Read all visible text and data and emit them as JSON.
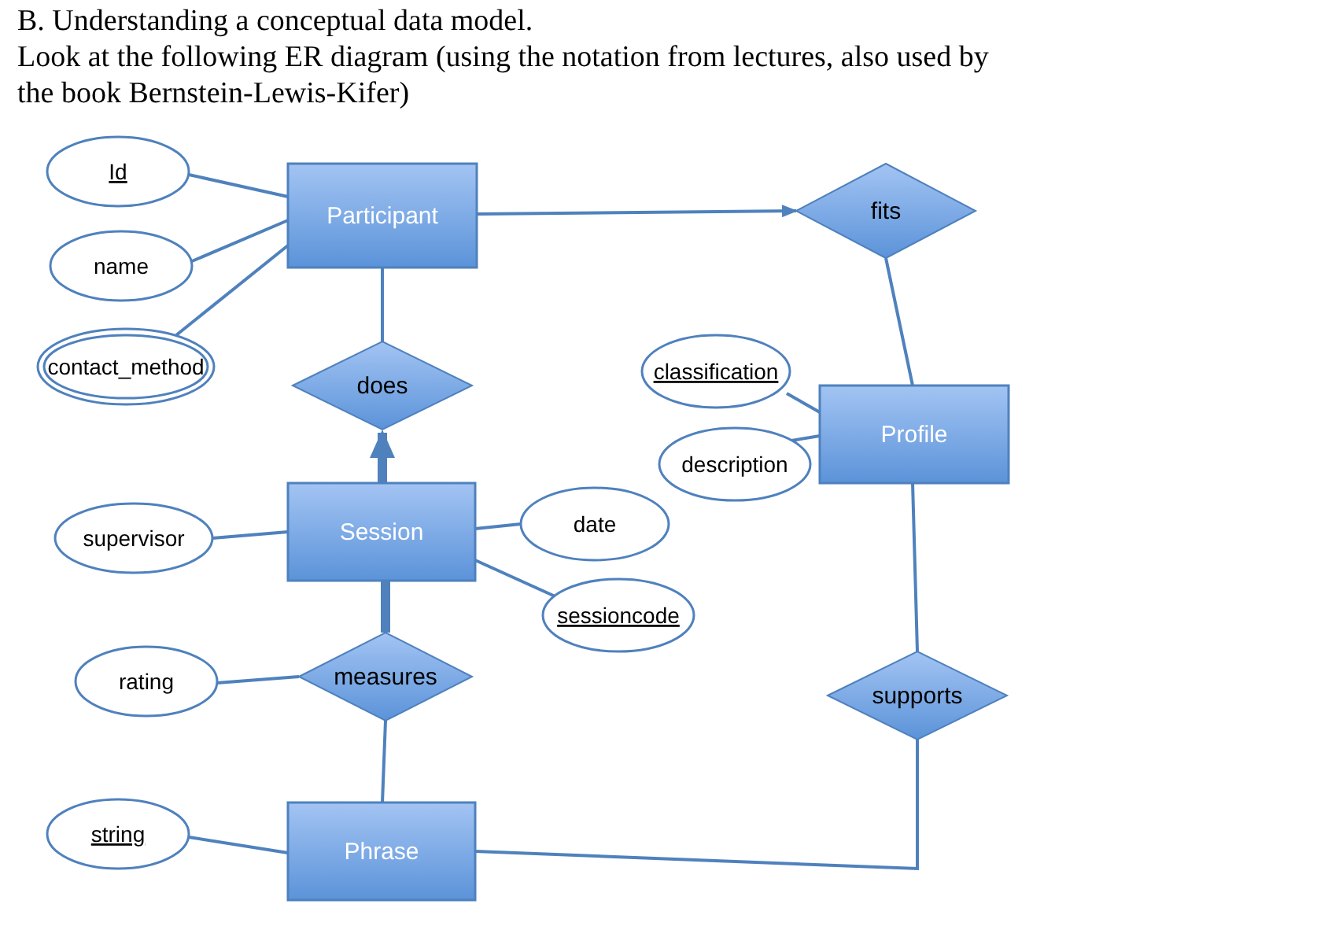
{
  "heading": {
    "title": "B. Understanding a conceptual data model.",
    "lines": [
      "Look at the following ER diagram (using the notation from lectures, also used by",
      "the book Bernstein-Lewis-Kifer)"
    ]
  },
  "diagram": {
    "entities": [
      {
        "name": "Participant"
      },
      {
        "name": "Session"
      },
      {
        "name": "Profile"
      },
      {
        "name": "Phrase"
      }
    ],
    "relationships": [
      {
        "name": "fits"
      },
      {
        "name": "does"
      },
      {
        "name": "measures"
      },
      {
        "name": "supports"
      }
    ],
    "attributes": [
      {
        "label": "Id",
        "key": true,
        "multivalued": false
      },
      {
        "label": "name",
        "key": false,
        "multivalued": false
      },
      {
        "label": "contact_method",
        "key": false,
        "multivalued": true
      },
      {
        "label": "supervisor",
        "key": false,
        "multivalued": false
      },
      {
        "label": "rating",
        "key": false,
        "multivalued": false
      },
      {
        "label": "string",
        "key": true,
        "multivalued": false
      },
      {
        "label": "classification",
        "key": true,
        "multivalued": false
      },
      {
        "label": "description",
        "key": false,
        "multivalued": false
      },
      {
        "label": "date",
        "key": false,
        "multivalued": false
      },
      {
        "label": "sessioncode",
        "key": true,
        "multivalued": false
      }
    ],
    "connections": [
      {
        "kind": "line"
      },
      {
        "kind": "line"
      },
      {
        "kind": "line"
      },
      {
        "kind": "arrow"
      },
      {
        "kind": "line"
      },
      {
        "kind": "line"
      },
      {
        "kind": "bold_arrow"
      },
      {
        "kind": "line"
      },
      {
        "kind": "line"
      },
      {
        "kind": "line"
      },
      {
        "kind": "line"
      },
      {
        "kind": "line"
      },
      {
        "kind": "bold_line"
      },
      {
        "kind": "line"
      },
      {
        "kind": "line"
      },
      {
        "kind": "line"
      },
      {
        "kind": "line"
      },
      {
        "kind": "line"
      }
    ]
  }
}
